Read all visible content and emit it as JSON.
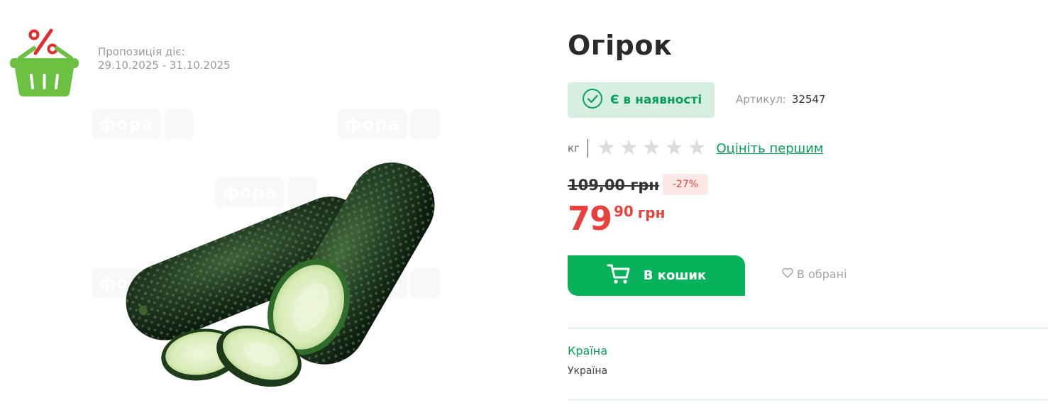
{
  "offer": {
    "label": "Пропозиція діє:",
    "period": "29.10.2025 - 31.10.2025"
  },
  "promo_badge": {
    "icon": "discount-basket-icon",
    "accent": "#e42a2a",
    "basket_color": "#6cc142"
  },
  "watermark": {
    "text": "фора"
  },
  "product": {
    "title": "Огірок",
    "stock_label": "Є в наявності",
    "sku_label": "Артикул:",
    "sku": "32547",
    "unit": "кг",
    "rating": {
      "max": 5,
      "value": 0
    },
    "rate_link": "Оцініть першим",
    "old_price": "109,00 грн",
    "discount": "-27%",
    "price": {
      "integer": "79",
      "fraction": "90",
      "currency": "грн"
    },
    "cart_button": "В кошик",
    "favorite": "В обрані"
  },
  "attributes": [
    {
      "label": "Країна",
      "value": "Україна"
    }
  ],
  "colors": {
    "brand_green": "#07b25b",
    "price_red": "#e8403c",
    "stock_bg": "#d7efe2"
  }
}
